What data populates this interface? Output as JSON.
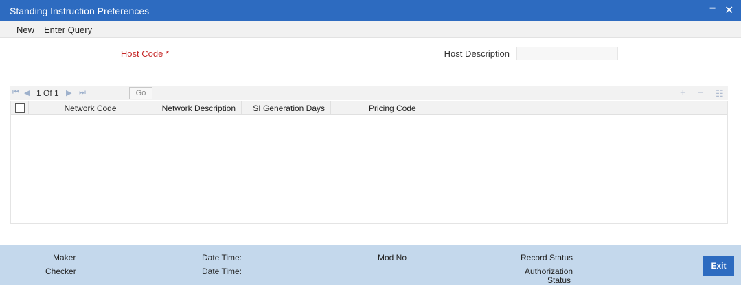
{
  "window": {
    "title": "Standing Instruction Preferences",
    "minimize_icon": "−",
    "close_icon": "✕"
  },
  "menu": {
    "new": "New",
    "enter_query": "Enter Query"
  },
  "form": {
    "host_code_label": "Host Code *",
    "host_code_value": "",
    "host_description_label": "Host Description",
    "host_description_value": ""
  },
  "grid": {
    "pagination": {
      "first_icon": "⏮",
      "prev_icon": "◀",
      "text": "1 Of 1",
      "next_icon": "▶",
      "last_icon": "⏭",
      "page_input": "",
      "go_label": "Go"
    },
    "actions": {
      "add_icon": "+",
      "delete_icon": "−",
      "columns_icon": "☷"
    },
    "columns": [
      "Network Code",
      "Network Description",
      "SI Generation Days",
      "Pricing Code"
    ],
    "rows": []
  },
  "footer": {
    "maker": "Maker",
    "checker": "Checker",
    "date_time_1": "Date Time:",
    "date_time_2": "Date Time:",
    "mod_no": "Mod No",
    "record_status": "Record Status",
    "authorization_status_line1": "Authorization",
    "authorization_status_line2": "Status",
    "exit_label": "Exit"
  },
  "colors": {
    "titlebar": "#2d6bc0",
    "footer": "#c4d8ec",
    "required_label": "#c62828"
  }
}
